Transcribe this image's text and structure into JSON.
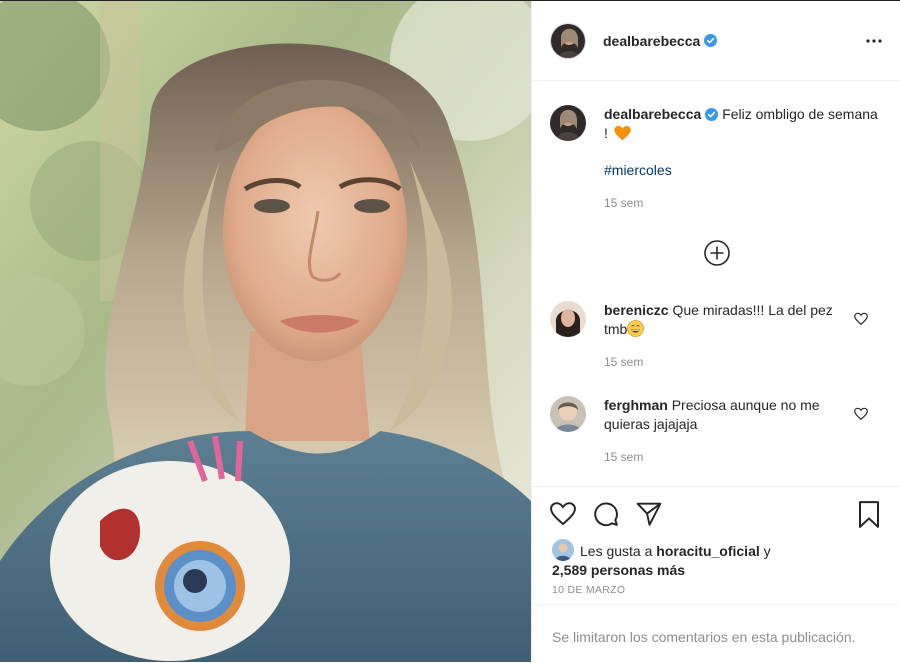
{
  "post": {
    "author": "dealbarebecca",
    "verified": true,
    "caption_text": "Feliz ombligo de semana !",
    "caption_emoji": "orange-heart",
    "hashtag": "#miercoles",
    "caption_time": "15 sem"
  },
  "comments": [
    {
      "username": "bereniczc",
      "text": "Que miradas!!! La del pez tmb",
      "emoji": "grinning-face",
      "time": "15 sem"
    },
    {
      "username": "ferghman",
      "text": "Preciosa aunque no me quieras jajajaja",
      "time": "15 sem"
    }
  ],
  "likes": {
    "prefix": "Les gusta a",
    "liker": "horacitu_oficial",
    "connector": "y",
    "others": "2,589 personas más"
  },
  "date": "10 DE MARZO",
  "comments_limited": "Se limitaron los comentarios en esta publicación.",
  "icons": {
    "more": "more-horizontal-icon",
    "load_more": "plus-circle-icon",
    "like": "heart-outline-icon",
    "comment": "comment-bubble-icon",
    "share": "paper-plane-icon",
    "save": "bookmark-icon",
    "verified": "verified-badge-icon"
  },
  "colors": {
    "link": "#00376b",
    "muted": "#8e8e8e",
    "verified": "#3897f0",
    "text": "#262626"
  }
}
